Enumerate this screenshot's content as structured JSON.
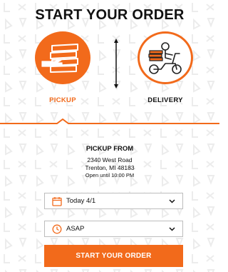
{
  "page": {
    "title": "START YOUR ORDER"
  },
  "options": {
    "pickup": {
      "label": "PICKUP",
      "icon": "pizza-boxes-hand-icon",
      "selected": true
    },
    "delivery": {
      "label": "DELIVERY",
      "icon": "delivery-scooter-icon",
      "selected": false
    }
  },
  "pickup_from": {
    "heading": "PICKUP FROM",
    "street": "2340 West Road",
    "city_state_zip": "Trenton, MI 48183",
    "hours": "Open until 10:00 PM"
  },
  "date_select": {
    "value": "Today 4/1",
    "icon": "calendar-icon"
  },
  "time_select": {
    "value": "ASAP",
    "icon": "clock-icon"
  },
  "start_button": {
    "label": "START YOUR ORDER"
  },
  "colors": {
    "accent": "#f26a1b",
    "text": "#111111",
    "border": "#bdbdbd",
    "pattern": "#efefef"
  }
}
